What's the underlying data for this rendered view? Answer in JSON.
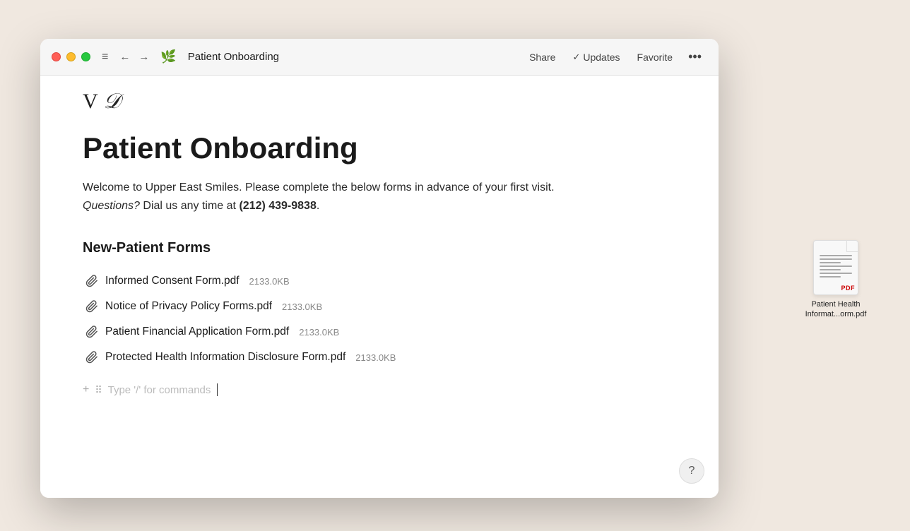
{
  "desktop": {
    "background_color": "#f0e8e0"
  },
  "window": {
    "title": "Patient Onboarding"
  },
  "titlebar": {
    "traffic_lights": {
      "close": "close",
      "minimize": "minimize",
      "maximize": "maximize"
    },
    "menu_icon": "≡",
    "back_arrow": "←",
    "forward_arrow": "→",
    "doc_icon": "🌿",
    "title": "Patient Onboarding",
    "share_label": "Share",
    "updates_checkmark": "✓",
    "updates_label": "Updates",
    "favorite_label": "Favorite",
    "more_icon": "•••"
  },
  "header_logos": {
    "logo1": "V",
    "logo2": "D"
  },
  "page": {
    "title": "Patient Onboarding",
    "description_part1": "Welcome to Upper East Smiles. Please complete the below forms in advance of your first visit. ",
    "description_italic": "Questions?",
    "description_part2": " Dial us any time at ",
    "description_phone": "(212) 439-9838",
    "description_end": ".",
    "section_heading": "New-Patient Forms",
    "files": [
      {
        "name": "Informed Consent Form.pdf",
        "size": "2133.0KB"
      },
      {
        "name": "Notice of Privacy Policy Forms.pdf",
        "size": "2133.0KB"
      },
      {
        "name": "Patient Financial Application Form.pdf",
        "size": "2133.0KB"
      },
      {
        "name": "Protected Health Information Disclosure Form.pdf",
        "size": "2133.0KB"
      }
    ],
    "command_placeholder": "Type '/' for commands"
  },
  "help_button": {
    "label": "?"
  },
  "desktop_file": {
    "name": "Patient Health Informat...orm.pdf",
    "badge": "PDF"
  }
}
